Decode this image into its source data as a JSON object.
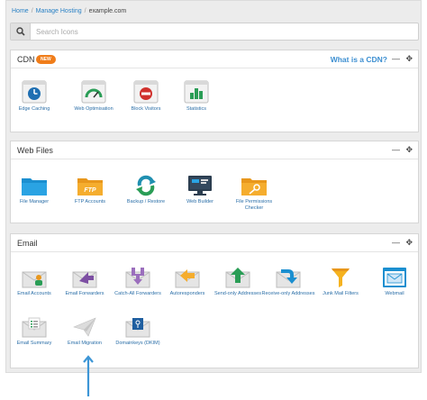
{
  "breadcrumb": {
    "home": "Home",
    "hosting": "Manage Hosting",
    "domain": "example.com"
  },
  "search": {
    "placeholder": "Search Icons"
  },
  "cdn": {
    "title": "CDN",
    "badge": "NEW",
    "help": "What is a CDN?",
    "items": [
      {
        "label": "Edge Caching",
        "icon": "clock-icon"
      },
      {
        "label": "Web Optimisation",
        "icon": "gauge-icon"
      },
      {
        "label": "Block Visitors",
        "icon": "block-icon"
      },
      {
        "label": "Statistics",
        "icon": "bar-chart-icon"
      }
    ]
  },
  "webfiles": {
    "title": "Web Files",
    "items": [
      {
        "label": "File Manager",
        "icon": "folder-icon"
      },
      {
        "label": "FTP Accounts",
        "icon": "ftp-folder-icon"
      },
      {
        "label": "Backup / Restore",
        "icon": "backup-icon"
      },
      {
        "label": "Web Builder",
        "icon": "monitor-icon"
      },
      {
        "label": "File Permissions Checker",
        "icon": "key-folder-icon"
      }
    ]
  },
  "email": {
    "title": "Email",
    "items": [
      {
        "label": "Email Accounts",
        "icon": "envelope-user-icon"
      },
      {
        "label": "Email Forwarders",
        "icon": "envelope-forward-icon"
      },
      {
        "label": "Catch-All Forwarders",
        "icon": "envelope-catchall-icon"
      },
      {
        "label": "Autoresponders",
        "icon": "envelope-reply-icon"
      },
      {
        "label": "Send-only Addresses",
        "icon": "envelope-send-icon"
      },
      {
        "label": "Receive-only Addresses",
        "icon": "envelope-receive-icon"
      },
      {
        "label": "Junk Mail Filters",
        "icon": "funnel-icon"
      },
      {
        "label": "Webmail",
        "icon": "webmail-icon"
      },
      {
        "label": "Email Summary",
        "icon": "envelope-list-icon"
      },
      {
        "label": "Email Migration",
        "icon": "paper-plane-icon"
      },
      {
        "label": "Domainkeys (DKIM)",
        "icon": "envelope-key-icon"
      }
    ]
  },
  "controls": {
    "minimise": "—",
    "move": "✥"
  },
  "colors": {
    "accent": "#3d8fd1",
    "badge": "#f07d1a",
    "link": "#2b6fa8",
    "arrow": "#3d96d6"
  }
}
